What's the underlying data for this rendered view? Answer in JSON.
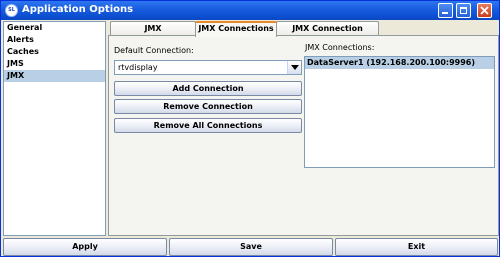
{
  "window": {
    "title": "Application Options",
    "app_icon_text": "SL",
    "titlebar_color": "#0d4fd1",
    "icons": [
      "minimize-icon",
      "maximize-icon",
      "close-icon"
    ]
  },
  "sidebar": {
    "items": [
      {
        "label": "General",
        "selected": false
      },
      {
        "label": "Alerts",
        "selected": false
      },
      {
        "label": "Caches",
        "selected": false
      },
      {
        "label": "JMS",
        "selected": false
      },
      {
        "label": "JMX",
        "selected": true
      }
    ],
    "selected_color": "#b8cfe5"
  },
  "tabs": [
    {
      "label": "JMX Administration",
      "active": false
    },
    {
      "label": "JMX Connections",
      "active": true
    },
    {
      "label": "JMX Connection Groups",
      "active": false
    }
  ],
  "panel": {
    "default_connection_label": "Default Connection:",
    "default_connection_value": "rtvdisplay",
    "add_button": "Add Connection",
    "remove_button": "Remove Connection",
    "remove_all_button": "Remove All Connections",
    "connections_label": "JMX Connections:",
    "connections": [
      "DataServer1 (192.168.200.100:9996)"
    ]
  },
  "footer": {
    "apply": "Apply",
    "save": "Save",
    "exit": "Exit"
  }
}
